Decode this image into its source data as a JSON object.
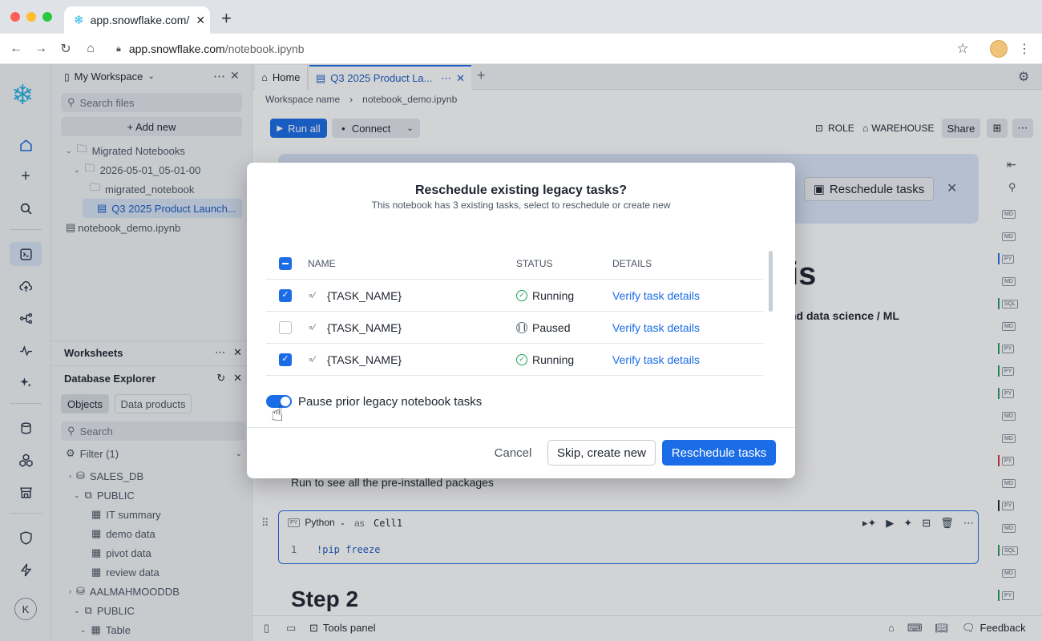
{
  "browser": {
    "tab_title": "app.snowflake.com/",
    "url_host": "app.snowflake.com",
    "url_path": "/notebook.ipynb"
  },
  "files_panel": {
    "workspace": "My Workspace",
    "search_placeholder": "Search files",
    "add_new": "+ Add new",
    "tree": [
      "Migrated Notebooks",
      "2026-05-01_05-01-00",
      "migrated_notebook",
      "Q3 2025 Product Launch...",
      "notebook_demo.ipynb"
    ],
    "worksheets": "Worksheets",
    "db_explorer": "Database Explorer",
    "objects_tab": "Objects",
    "data_products_tab": "Data products",
    "search2": "Search",
    "filter": "Filter (1)",
    "db_tree": [
      "SALES_DB",
      "PUBLIC",
      "IT summary",
      "demo data",
      "pivot data",
      "review data",
      "AALMAHMOODDB",
      "PUBLIC",
      "Table"
    ]
  },
  "main": {
    "home_tab": "Home",
    "nb_tab": "Q3 2025 Product La...",
    "breadcrumb_ws": "Workspace name",
    "breadcrumb_file": "notebook_demo.ipynb",
    "run_all": "Run all",
    "connect": "Connect",
    "role": "ROLE",
    "warehouse": "WAREHOUSE",
    "share": "Share",
    "banner_button": "Reschedule tasks",
    "heading_frag": "is",
    "sub_frag": "nd data science / ML",
    "run_text": "Run to see all the pre-installed packages",
    "cell_lang": "Python",
    "cell_as": "as",
    "cell_name": "Cell1",
    "line_no": "1",
    "code": "!pip freeze",
    "step2": "Step 2",
    "tools_panel": "Tools panel",
    "feedback": "Feedback"
  },
  "modal": {
    "title": "Reschedule existing legacy tasks?",
    "subtitle": "This notebook has 3 existing tasks, select to reschedule or create new",
    "col_name": "NAME",
    "col_status": "STATUS",
    "col_details": "DETAILS",
    "rows": [
      {
        "name": "{TASK_NAME}",
        "status": "Running",
        "details": "Verify task details",
        "checked": true
      },
      {
        "name": "{TASK_NAME}",
        "status": "Paused",
        "details": "Verify task details",
        "checked": false
      },
      {
        "name": "{TASK_NAME}",
        "status": "Running",
        "details": "Verify task details",
        "checked": true
      }
    ],
    "toggle_label": "Pause prior legacy notebook tasks",
    "toggle_on": true,
    "cancel": "Cancel",
    "skip": "Skip, create new",
    "reschedule": "Reschedule tasks"
  },
  "right_strip": [
    "MD",
    "MD",
    "PY",
    "MD",
    "SQL",
    "MD",
    "PY",
    "PY",
    "PY",
    "MD",
    "MD",
    "PY",
    "MD",
    "PY",
    "MD",
    "SQL",
    "MD",
    "PY"
  ],
  "avatar_letter": "K",
  "colors": {
    "accent": "#1a6ce7",
    "brand": "#29b5e8",
    "running": "#1e9e5a"
  }
}
